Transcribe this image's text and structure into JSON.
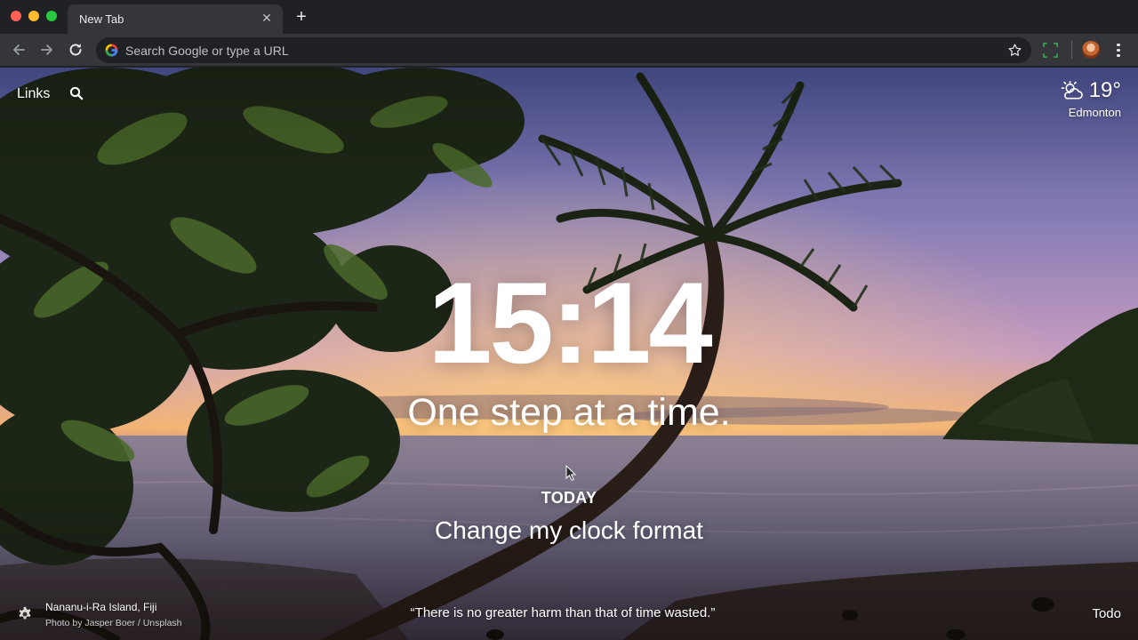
{
  "browser": {
    "tab": {
      "title": "New Tab",
      "close_icon": "close-icon"
    },
    "new_tab_icon": "plus-icon",
    "toolbar": {
      "back_icon": "arrow-left-icon",
      "forward_icon": "arrow-right-icon",
      "reload_icon": "reload-icon",
      "omnibox": {
        "value": "",
        "placeholder": "Search Google or type a URL",
        "icon": "google-icon"
      },
      "bookmark_icon": "star-icon",
      "extension_icon": "extension-icon",
      "profile_icon": "avatar",
      "menu_icon": "more-vertical-icon"
    }
  },
  "dashboard": {
    "links_label": "Links",
    "search_icon": "search-icon",
    "weather": {
      "icon": "partly-cloudy-icon",
      "temperature": "19°",
      "location": "Edmonton"
    },
    "clock": "15:14",
    "greeting": "One step at a time.",
    "focus": {
      "label": "TODAY",
      "text": "Change my clock format"
    },
    "photo": {
      "location": "Nananu-i-Ra Island, Fiji",
      "credit": "Photo by Jasper Boer / Unsplash"
    },
    "quote": "“There is no greater harm than that of time wasted.”",
    "todo_label": "Todo",
    "settings_icon": "gear-icon"
  },
  "colors": {
    "chrome_dark": "#202124",
    "chrome_toolbar": "#35363a",
    "sky_top": "#5a5fa0",
    "sky_mid": "#b79ac0",
    "sunset_glow": "#f2b36a",
    "sea": "#6a6a86",
    "sand": "#3a2c24"
  }
}
